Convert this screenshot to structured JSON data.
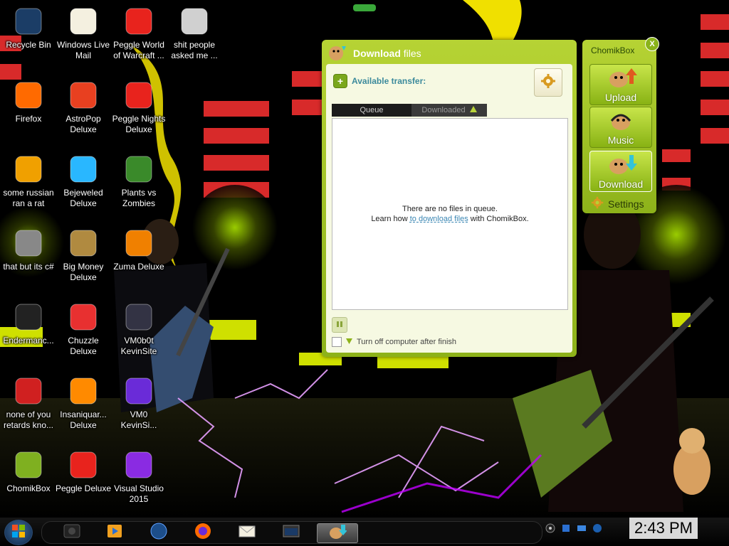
{
  "desktop": {
    "icons": [
      {
        "label": "Recycle Bin",
        "icon": "recycle-bin-icon"
      },
      {
        "label": "Windows Live\nMail",
        "icon": "mail-icon"
      },
      {
        "label": "Peggle World\nof Warcraft ...",
        "icon": "peggle-icon"
      },
      {
        "label": "shit people\nasked me ...",
        "icon": "folder-icon"
      },
      {
        "label": "Firefox",
        "icon": "firefox-icon"
      },
      {
        "label": "AstroPop\nDeluxe",
        "icon": "astropop-icon"
      },
      {
        "label": "Peggle Nights\nDeluxe",
        "icon": "peggle-icon"
      },
      {
        "label": "some russian\nran a rat",
        "icon": "app-icon"
      },
      {
        "label": "Bejeweled\nDeluxe",
        "icon": "gem-icon"
      },
      {
        "label": "Plants vs\nZombies",
        "icon": "plant-icon"
      },
      {
        "label": "that but its c#",
        "icon": "window-stack-icon"
      },
      {
        "label": "Big Money\nDeluxe",
        "icon": "money-bag-icon"
      },
      {
        "label": "Zuma Deluxe",
        "icon": "zuma-icon"
      },
      {
        "label": "Endermanc...",
        "icon": "terminal-icon"
      },
      {
        "label": "Chuzzle\nDeluxe",
        "icon": "chuzzle-icon"
      },
      {
        "label": "VM0b0t\nKevinSite",
        "icon": "document-icon"
      },
      {
        "label": "none of you\nretards kno...",
        "icon": "rat-icon"
      },
      {
        "label": "Insaniquar...\nDeluxe",
        "icon": "fish-icon"
      },
      {
        "label": "VM0\nKevinSi...",
        "icon": "firefox-doc-icon"
      },
      {
        "label": "ChomikBox",
        "icon": "hamster-icon"
      },
      {
        "label": "Peggle Deluxe",
        "icon": "peggle-icon"
      },
      {
        "label": "Visual Studio\n2015",
        "icon": "visual-studio-icon"
      }
    ]
  },
  "download_window": {
    "title_bold": "Download",
    "title_rest": "files",
    "available_transfer": "Available transfer:",
    "tabs": {
      "queue": "Queue",
      "downloaded": "Downloaded"
    },
    "empty_line1": "There are no files in queue.",
    "learn_prefix": "Learn how ",
    "learn_link": "to download files",
    "learn_suffix": " with ChomikBox.",
    "shutdown_label": "Turn off computer after finish"
  },
  "side_panel": {
    "title": "ChomikBox",
    "close": "X",
    "upload": "Upload",
    "music": "Music",
    "download": "Download",
    "settings": "Settings"
  },
  "taskbar": {
    "clock": "2:43 PM"
  },
  "colors": {
    "window_green": "#9cc021",
    "link_blue": "#3a86b3"
  }
}
